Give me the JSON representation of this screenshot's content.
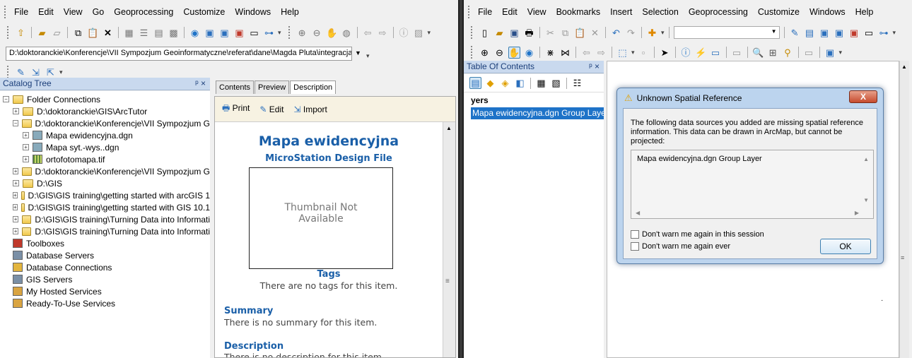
{
  "catalog": {
    "menu": [
      "File",
      "Edit",
      "View",
      "Go",
      "Geoprocessing",
      "Customize",
      "Windows",
      "Help"
    ],
    "location_path": "D:\\doktoranckie\\Konferencje\\VII Sympozjum Geoinformatyczne\\referat\\dane\\Magda Pluta\\integracja",
    "catalog_tree_title": "Catalog Tree",
    "pin_glyph": "ᵖ ×",
    "tree": [
      {
        "label": "Folder Connections",
        "indent": 0,
        "icon": "folder-connections-icon",
        "exp": "−"
      },
      {
        "label": "D:\\doktoranckie\\GIS\\ArcTutor",
        "indent": 1,
        "icon": "folder-icon",
        "exp": "+"
      },
      {
        "label": "D:\\doktoranckie\\Konferencje\\VII Sympozjum G",
        "indent": 1,
        "icon": "folder-icon",
        "exp": "−"
      },
      {
        "label": "Mapa ewidencyjna.dgn",
        "indent": 2,
        "icon": "cad-dataset-icon",
        "exp": "+"
      },
      {
        "label": "Mapa syt.-wys..dgn",
        "indent": 2,
        "icon": "cad-dataset-icon",
        "exp": "+"
      },
      {
        "label": "ortofotomapa.tif",
        "indent": 2,
        "icon": "raster-icon",
        "exp": "+"
      },
      {
        "label": "D:\\doktoranckie\\Konferencje\\VII Sympozjum G",
        "indent": 1,
        "icon": "folder-icon",
        "exp": "+"
      },
      {
        "label": "D:\\GIS",
        "indent": 1,
        "icon": "folder-icon",
        "exp": "+"
      },
      {
        "label": "D:\\GIS\\GIS training\\getting started with arcGIS 1",
        "indent": 1,
        "icon": "folder-icon",
        "exp": "+"
      },
      {
        "label": "D:\\GIS\\GIS training\\getting started with GIS 10.1",
        "indent": 1,
        "icon": "folder-icon",
        "exp": "+"
      },
      {
        "label": "D:\\GIS\\GIS training\\Turning Data into Informati",
        "indent": 1,
        "icon": "folder-icon",
        "exp": "+"
      },
      {
        "label": "D:\\GIS\\GIS training\\Turning Data into Informati",
        "indent": 1,
        "icon": "folder-icon",
        "exp": "+"
      },
      {
        "label": "Toolboxes",
        "indent": 0,
        "icon": "toolbox-icon",
        "exp": ""
      },
      {
        "label": "Database Servers",
        "indent": 0,
        "icon": "database-server-icon",
        "exp": ""
      },
      {
        "label": "Database Connections",
        "indent": 0,
        "icon": "database-connection-icon",
        "exp": ""
      },
      {
        "label": "GIS Servers",
        "indent": 0,
        "icon": "gis-server-icon",
        "exp": ""
      },
      {
        "label": "My Hosted Services",
        "indent": 0,
        "icon": "hosted-services-icon",
        "exp": ""
      },
      {
        "label": "Ready-To-Use Services",
        "indent": 0,
        "icon": "ready-services-icon",
        "exp": ""
      }
    ],
    "tabs": [
      "Contents",
      "Preview",
      "Description"
    ],
    "active_tab": "Description",
    "desc_tools": {
      "print": "Print",
      "edit": "Edit",
      "import": "Import"
    },
    "item_title": "Mapa ewidencyjna",
    "item_type": "MicroStation Design File",
    "thumbnail_text": "Thumbnail Not Available",
    "tags_heading": "Tags",
    "tags_text": "There are no tags for this item.",
    "summary_heading": "Summary",
    "summary_text": "There is no summary for this item.",
    "description_heading": "Description",
    "description_text": "There is no description for this item."
  },
  "arcmap": {
    "menu": [
      "File",
      "Edit",
      "View",
      "Bookmarks",
      "Insert",
      "Selection",
      "Geoprocessing",
      "Customize",
      "Windows",
      "Help"
    ],
    "toc_title": "Table Of Contents",
    "toc_pin": "ᵖ ×",
    "toc_header": "yers",
    "toc_layer": "Mapa ewidencyjna.dgn Group Layer"
  },
  "dialog": {
    "title": "Unknown Spatial Reference",
    "message": "The following data sources you added are missing spatial reference information. This data can be drawn in ArcMap, but cannot be projected:",
    "list_item": "Mapa ewidencyjna.dgn Group Layer",
    "check1": "Don't warn me again in this session",
    "check2": "Don't warn me again ever",
    "ok": "OK",
    "close": "X"
  },
  "colors": {
    "accent_heading": "#1a5fa8",
    "dialog_frame": "#bcd4ee",
    "selection": "#1e73c8"
  }
}
